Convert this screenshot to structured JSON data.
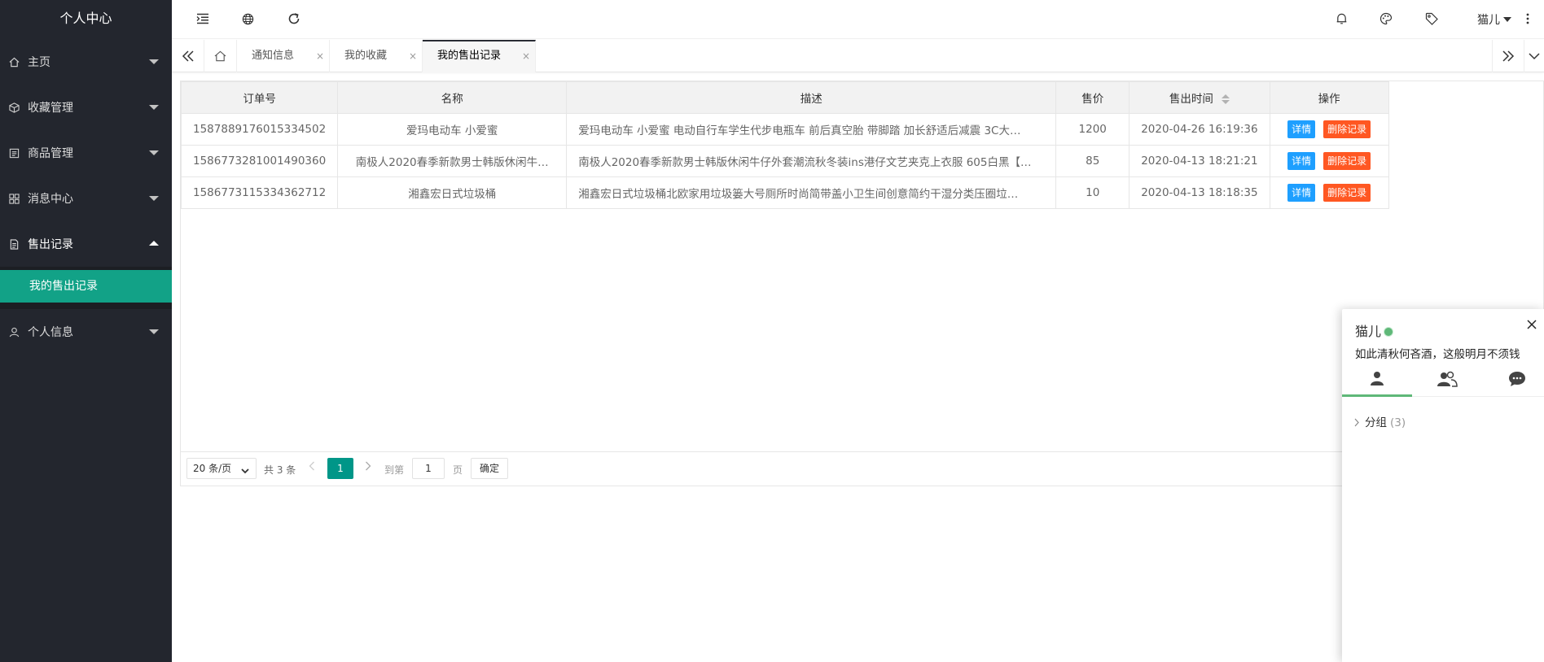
{
  "sidebar": {
    "title": "个人中心",
    "items": [
      {
        "label": "主页",
        "icon": "home-icon"
      },
      {
        "label": "收藏管理",
        "icon": "box-icon"
      },
      {
        "label": "商品管理",
        "icon": "list-icon"
      },
      {
        "label": "消息中心",
        "icon": "grid-icon"
      },
      {
        "label": "售出记录",
        "icon": "document-icon"
      },
      {
        "label": "个人信息",
        "icon": "user-icon"
      }
    ],
    "sub_items": [
      {
        "label": "我的售出记录"
      }
    ]
  },
  "header": {
    "user_name": "猫儿"
  },
  "tabs": [
    {
      "label": "通知信息",
      "close": "×"
    },
    {
      "label": "我的收藏",
      "close": "×"
    },
    {
      "label": "我的售出记录",
      "close": "×"
    }
  ],
  "table": {
    "columns": [
      "订单号",
      "名称",
      "描述",
      "售价",
      "售出时间",
      "操作"
    ],
    "rows": [
      {
        "order_no": "1587889176015334502",
        "name": "爱玛电动车 小爱蜜",
        "desc": "爱玛电动车 小爱蜜 电动自行车学生代步电瓶车 前后真空胎 带脚踏 加长舒适后减震 3C大…",
        "price": "1200",
        "time": "2020-04-26 16:19:36"
      },
      {
        "order_no": "1586773281001490360",
        "name": "南极人2020春季新款男士韩版休闲牛…",
        "desc": "南极人2020春季新款男士韩版休闲牛仔外套潮流秋冬装ins港仔文艺夹克上衣服 605白黑【…",
        "price": "85",
        "time": "2020-04-13 18:21:21"
      },
      {
        "order_no": "1586773115334362712",
        "name": "湘鑫宏日式垃圾桶",
        "desc": "湘鑫宏日式垃圾桶北欧家用垃圾篓大号厕所时尚简带盖小卫生间创意简约干湿分类压圈垃…",
        "price": "10",
        "time": "2020-04-13 18:18:35"
      }
    ],
    "actions": {
      "detail": "详情",
      "delete": "删除记录"
    }
  },
  "pager": {
    "page_size": "20 条/页",
    "total": "共 3 条",
    "current": "1",
    "goto_label": "到第",
    "goto_value": "1",
    "page_unit": "页",
    "confirm": "确定"
  },
  "chat": {
    "name": "猫儿",
    "signature": "如此清秋何吝酒，这般明月不须钱",
    "group_label": "分组",
    "group_count": "(3)"
  },
  "colors": {
    "sidebar_bg": "#23262e",
    "active_sub": "#12a287",
    "btn_blue": "#1e9fff",
    "btn_red": "#ff5722",
    "pager_current": "#009688",
    "online": "#5fb878"
  }
}
